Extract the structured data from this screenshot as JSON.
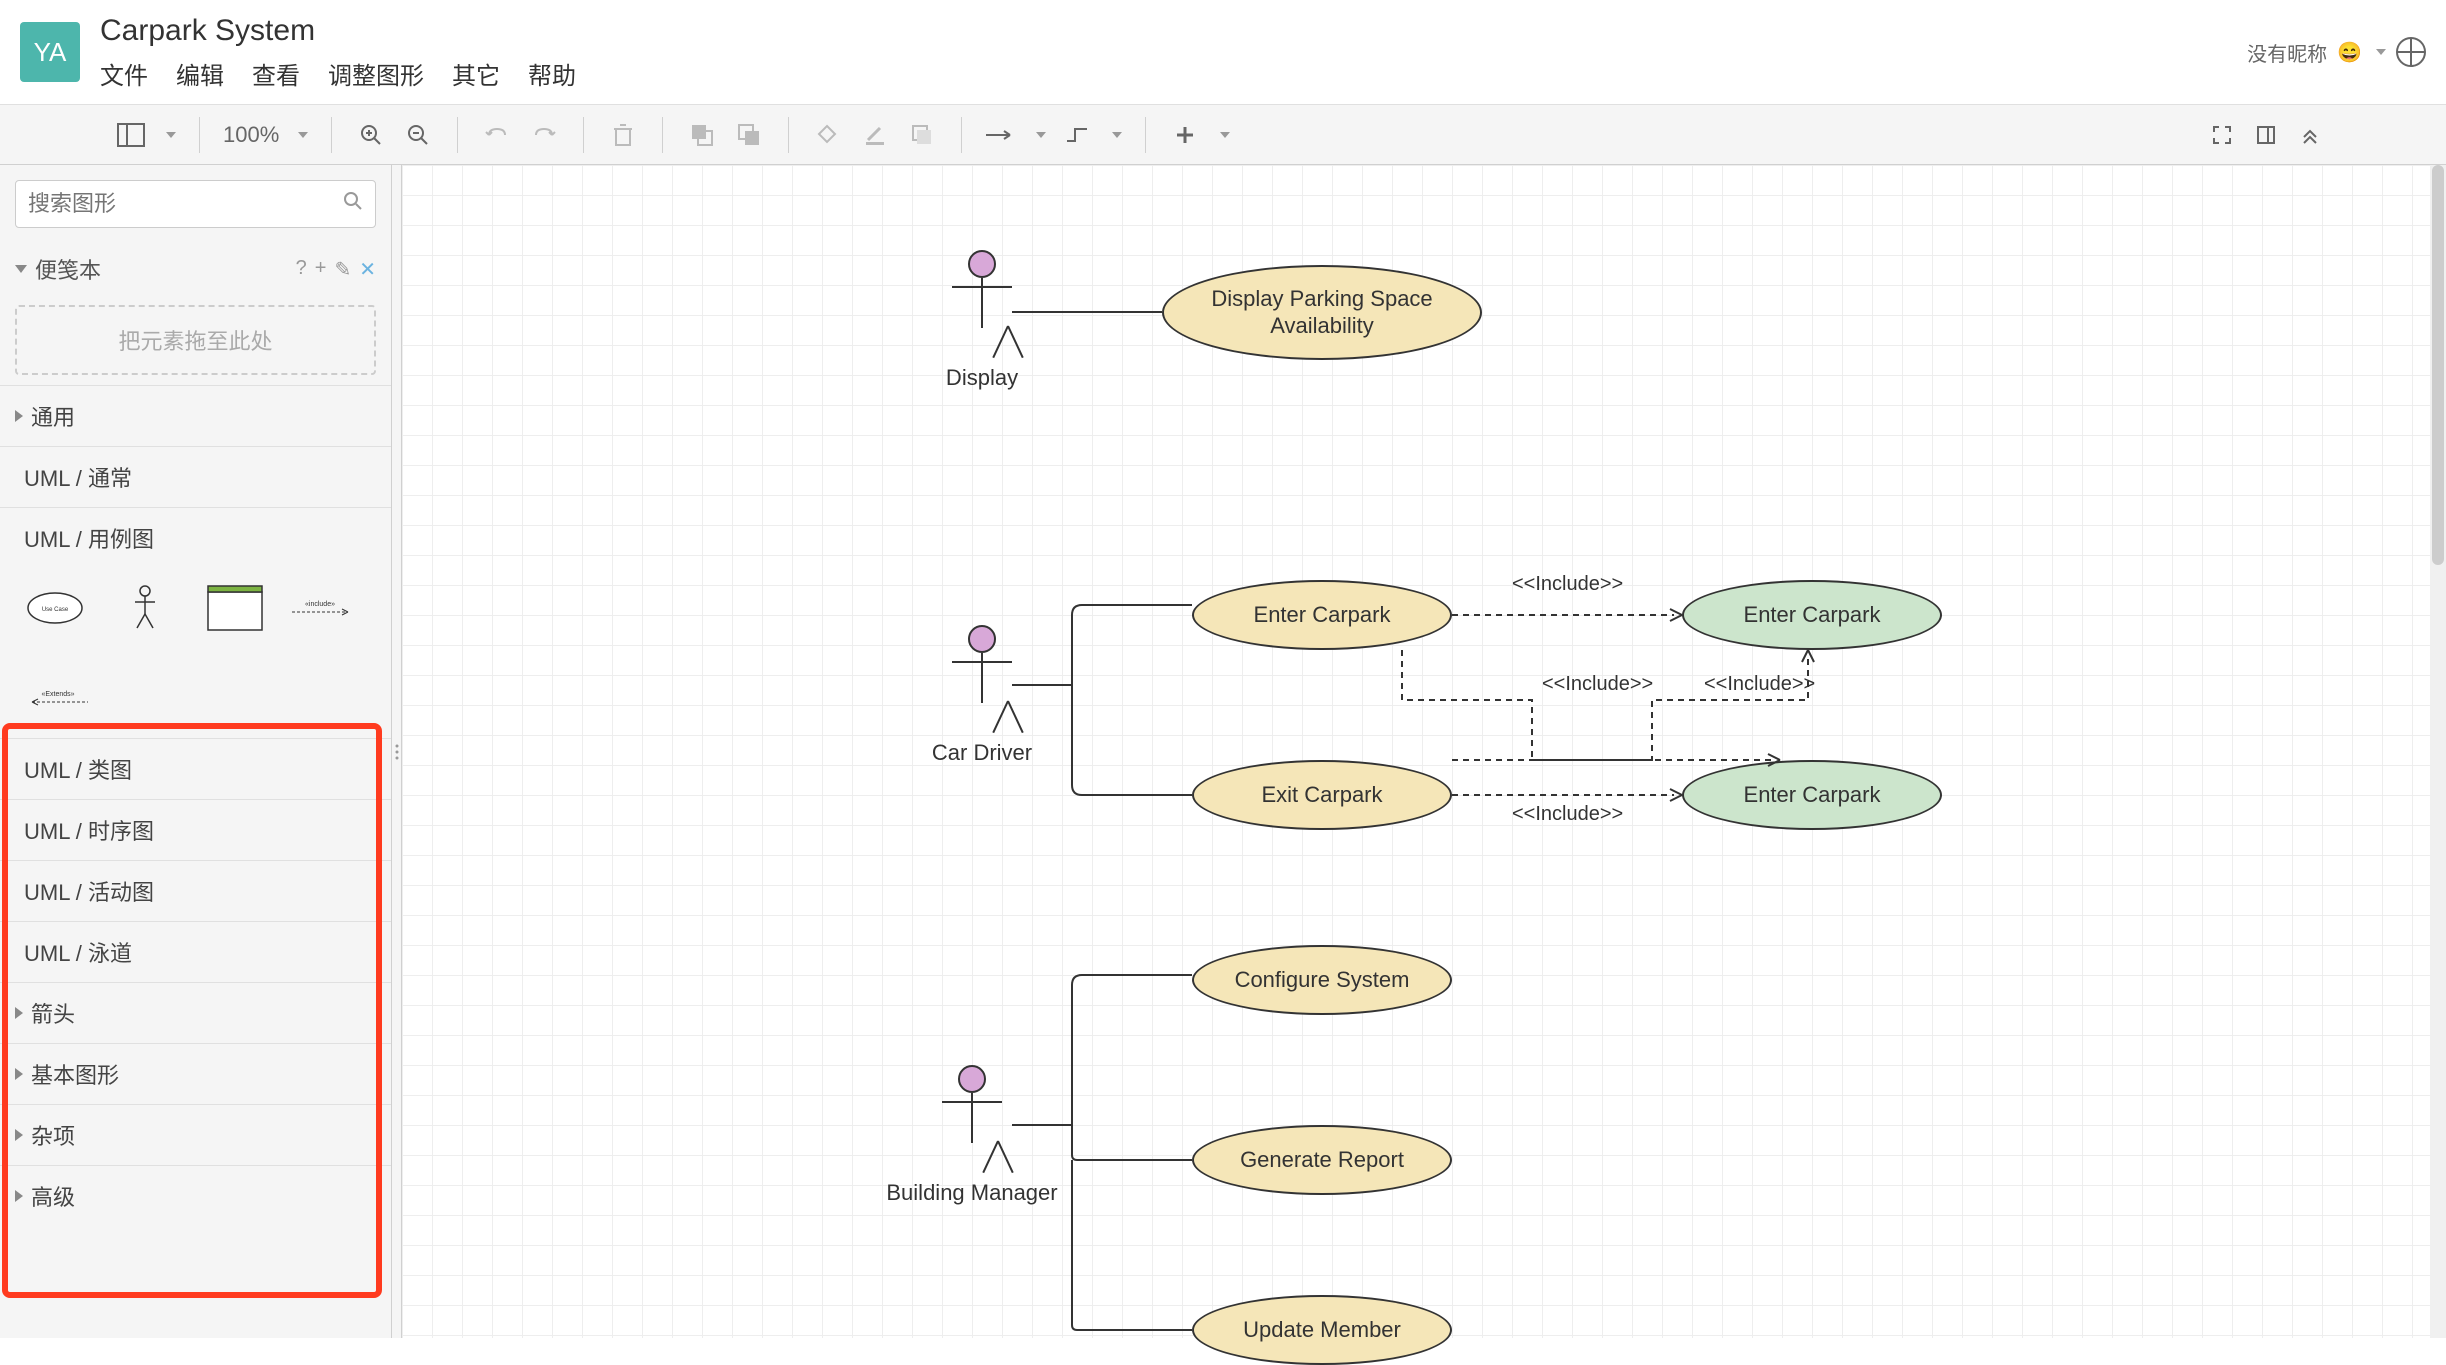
{
  "header": {
    "logo_text": "YA",
    "title": "Carpark System",
    "menu": [
      "文件",
      "编辑",
      "查看",
      "调整图形",
      "其它",
      "帮助"
    ],
    "user_label": "没有昵称"
  },
  "toolbar": {
    "zoom": "100%"
  },
  "sidebar": {
    "search_placeholder": "搜索图形",
    "scratchpad_title": "便笺本",
    "dropzone_hint": "把元素拖至此处",
    "categories": {
      "general": "通用",
      "uml_common": "UML / 通常",
      "uml_usecase": "UML / 用例图",
      "uml_class": "UML / 类图",
      "uml_sequence": "UML / 时序图",
      "uml_activity": "UML / 活动图",
      "uml_swimlane": "UML / 泳道",
      "arrows": "箭头",
      "basic_shapes": "基本图形",
      "misc": "杂项",
      "advanced": "高级"
    },
    "palette_items": {
      "usecase_shape": "Use Case",
      "include_label": "<<include>>",
      "extends_label": "<<Extends>>"
    }
  },
  "diagram": {
    "actors": {
      "display": "Display",
      "car_driver": "Car Driver",
      "building_manager": "Building Manager"
    },
    "usecases": {
      "display_parking": "Display Parking Space Availability",
      "enter_carpark_1": "Enter Carpark",
      "exit_carpark": "Exit Carpark",
      "enter_carpark_2": "Enter Carpark",
      "enter_carpark_3": "Enter Carpark",
      "configure_system": "Configure System",
      "generate_report": "Generate Report",
      "update_member": "Update Member"
    },
    "include_stereotype": "<<Include>>"
  }
}
